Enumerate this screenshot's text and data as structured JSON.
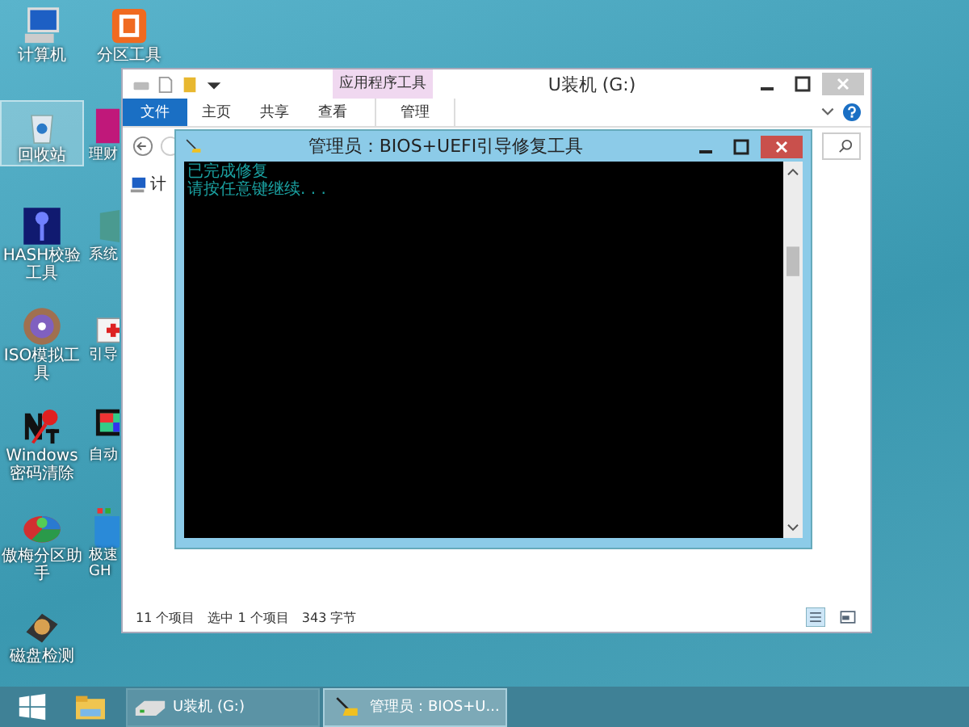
{
  "desktop": {
    "icons": [
      {
        "label": "计算机",
        "kind": "computer",
        "selected": false
      },
      {
        "label": "回收站",
        "kind": "trash",
        "selected": true
      },
      {
        "label": "HASH校验工具",
        "kind": "key",
        "selected": false
      },
      {
        "label": "ISO模拟工具",
        "kind": "disc",
        "selected": false
      },
      {
        "label": "Windows密码清除",
        "kind": "ntkey",
        "selected": false
      },
      {
        "label": "傲梅分区助手",
        "kind": "pie",
        "selected": false
      },
      {
        "label": "磁盘检测",
        "kind": "harddisk",
        "selected": false
      },
      {
        "label": "分区工具",
        "kind": "partition",
        "selected": false
      },
      {
        "label": "理财",
        "kind": "magenta",
        "selected": false
      },
      {
        "label": "系统",
        "kind": "system",
        "selected": false
      },
      {
        "label": "引导",
        "kind": "toolbox",
        "selected": false
      },
      {
        "label": "自动",
        "kind": "monitor",
        "selected": false
      },
      {
        "label": "极速 GH",
        "kind": "ghost",
        "selected": false
      }
    ]
  },
  "explorer": {
    "title": "U装机 (G:)",
    "context_group": "应用程序工具",
    "tabs": [
      {
        "label": "文件",
        "kind": "file"
      },
      {
        "label": "主页",
        "kind": "tab"
      },
      {
        "label": "共享",
        "kind": "tab"
      },
      {
        "label": "查看",
        "kind": "tab"
      },
      {
        "label": "管理",
        "kind": "context"
      }
    ],
    "nav_item": "计",
    "status": [
      "11 个项目",
      "选中 1 个项目",
      "343 字节"
    ]
  },
  "console": {
    "title": "管理员：BIOS+UEFI引导修复工具",
    "lines": [
      "已完成修复",
      "请按任意键继续. . ."
    ]
  },
  "taskbar": {
    "tasks": [
      {
        "label": "U装机 (G:)",
        "kind": "drive",
        "selected": false
      },
      {
        "label": "管理员：BIOS+U...",
        "kind": "tool",
        "selected": true
      }
    ]
  }
}
